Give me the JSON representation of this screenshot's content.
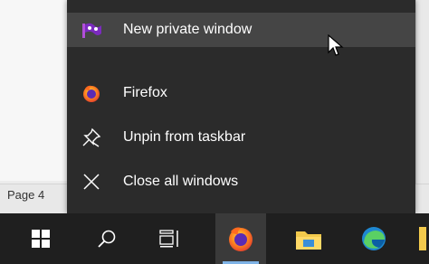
{
  "background": {
    "page_indicator": "Page 4"
  },
  "jumplist": {
    "items": [
      {
        "label": "New private window",
        "icon": "private-window-icon",
        "highlighted": true
      },
      {
        "label": "Firefox",
        "icon": "firefox-icon",
        "highlighted": false
      },
      {
        "label": "Unpin from taskbar",
        "icon": "unpin-icon",
        "highlighted": false
      },
      {
        "label": "Close all windows",
        "icon": "close-icon",
        "highlighted": false
      }
    ]
  },
  "taskbar": {
    "buttons": [
      {
        "icon": "windows-start-icon"
      },
      {
        "icon": "search-icon"
      },
      {
        "icon": "task-view-icon"
      },
      {
        "icon": "firefox-icon",
        "active": true
      },
      {
        "icon": "file-explorer-icon"
      },
      {
        "icon": "edge-icon"
      }
    ]
  },
  "colors": {
    "menu_bg": "#2b2b2b",
    "menu_highlight": "#454545",
    "taskbar_bg": "#1f1f1f",
    "active_accent": "#7fb3e6",
    "private_purple": "#9b3cc9"
  }
}
